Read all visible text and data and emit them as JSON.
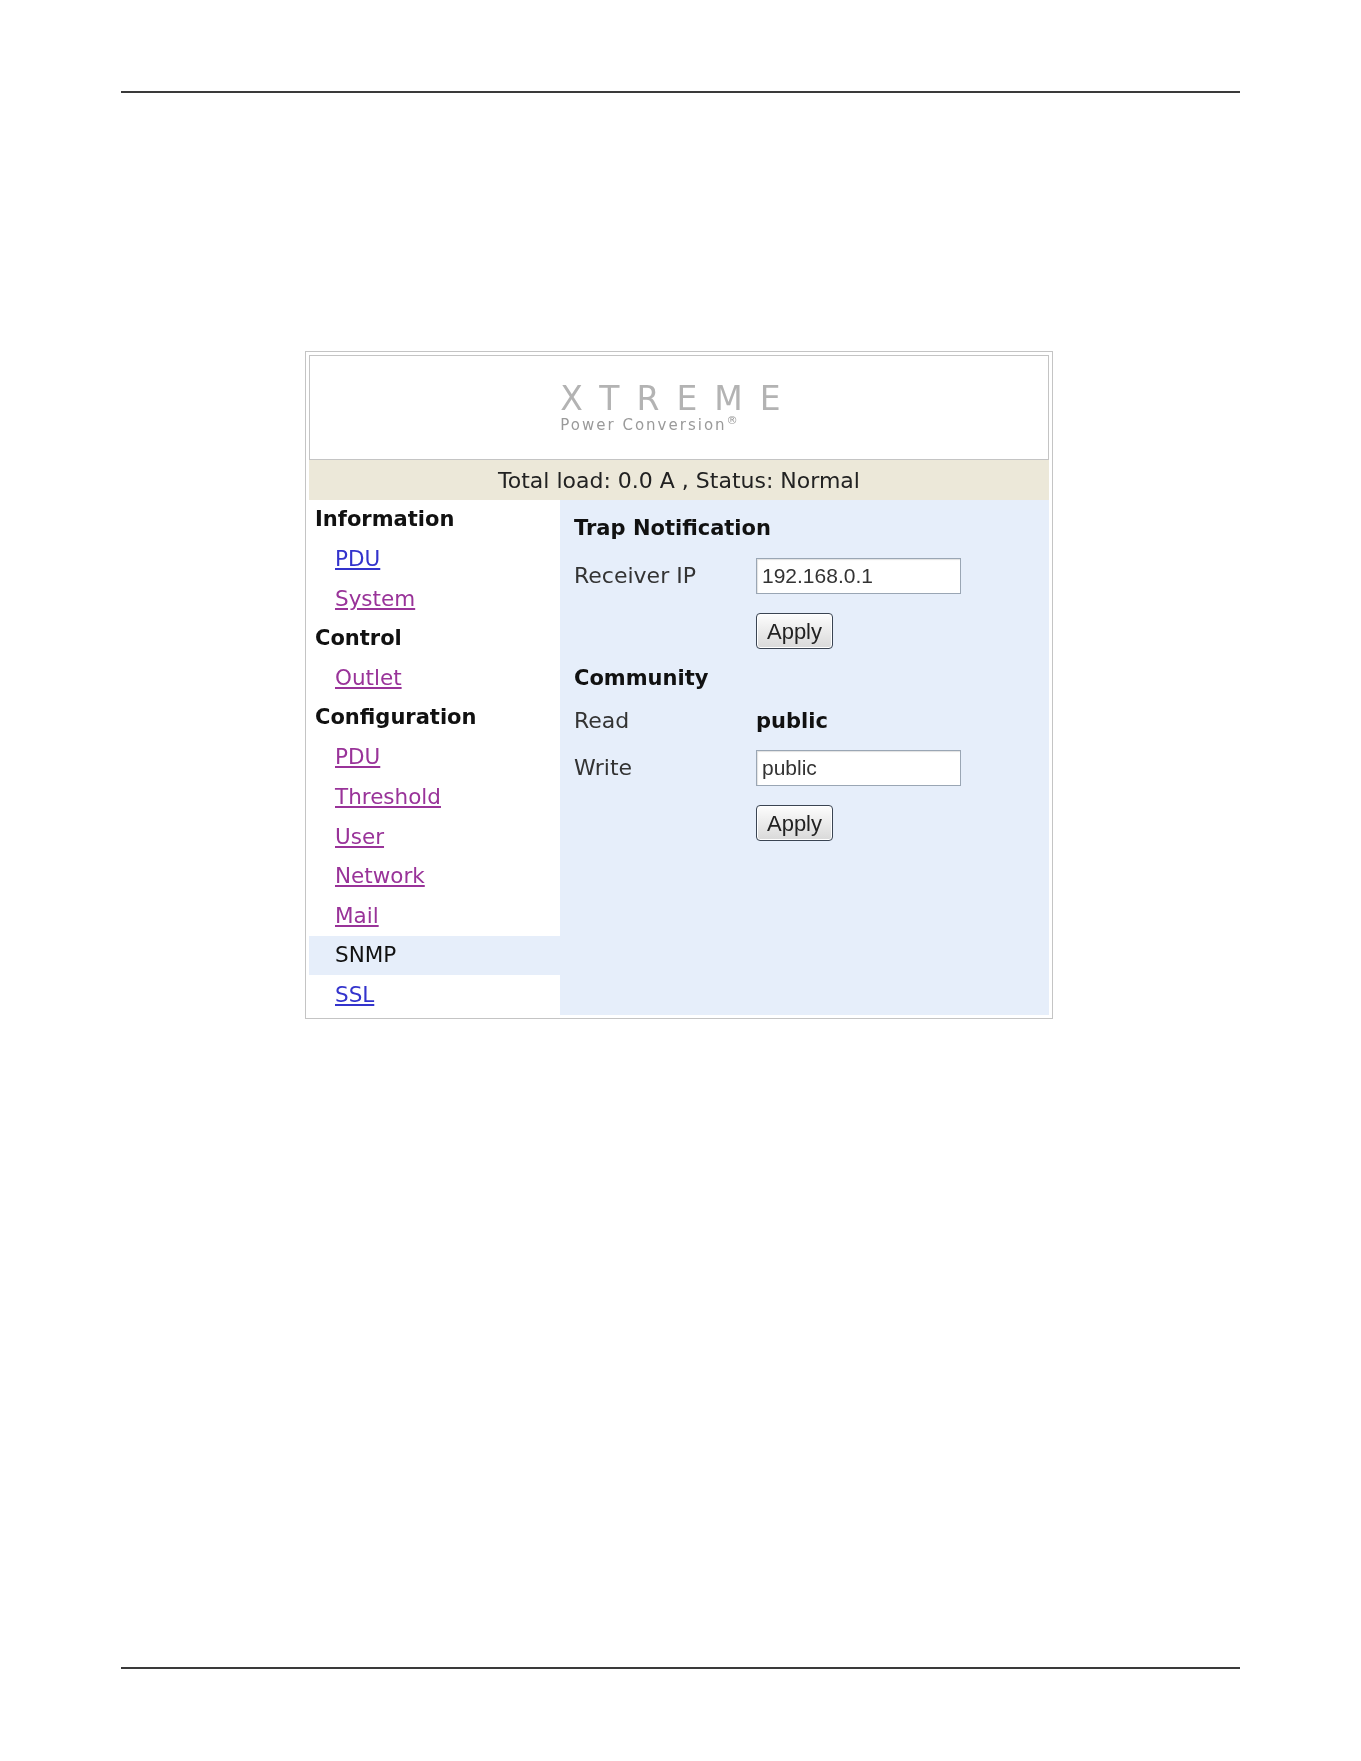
{
  "logo": {
    "wordmark": "XTREME",
    "tagline": "Power Conversion$^{®}$"
  },
  "status_bar": "Total load: 0.0 A , Status: Normal",
  "sidebar": {
    "sections": [
      {
        "heading": "Information",
        "items": [
          {
            "label": "PDU",
            "visited": false,
            "selected": false
          },
          {
            "label": "System",
            "visited": true,
            "selected": false
          }
        ]
      },
      {
        "heading": "Control",
        "items": [
          {
            "label": "Outlet",
            "visited": true,
            "selected": false
          }
        ]
      },
      {
        "heading": "Configuration",
        "items": [
          {
            "label": "PDU",
            "visited": true,
            "selected": false
          },
          {
            "label": "Threshold",
            "visited": true,
            "selected": false
          },
          {
            "label": "User",
            "visited": true,
            "selected": false
          },
          {
            "label": "Network",
            "visited": true,
            "selected": false
          },
          {
            "label": "Mail",
            "visited": true,
            "selected": false
          },
          {
            "label": "SNMP",
            "selected": true
          },
          {
            "label": "SSL",
            "visited": false,
            "selected": false
          }
        ]
      }
    ]
  },
  "content": {
    "sections": [
      {
        "title": "Trap Notification",
        "fields": [
          {
            "label": "Receiver IP",
            "kind": "input",
            "value": "192.168.0.1"
          }
        ],
        "button": "Apply"
      },
      {
        "title": "Community",
        "fields": [
          {
            "label": "Read",
            "kind": "text",
            "value": "public"
          },
          {
            "label": "Write",
            "kind": "input",
            "value": "public"
          }
        ],
        "button": "Apply"
      }
    ]
  }
}
